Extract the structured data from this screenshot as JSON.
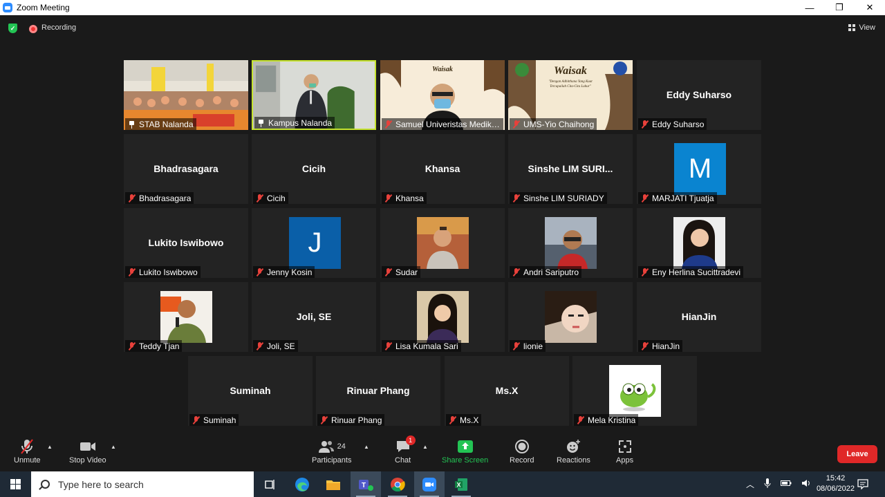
{
  "window": {
    "title": "Zoom Meeting",
    "min": "—",
    "restore": "❐",
    "close": "✕"
  },
  "topbar": {
    "recording_label": "Recording",
    "view_label": "View"
  },
  "tiles": [
    {
      "name": "STAB Nalanda",
      "icon": "pin",
      "kind": "video"
    },
    {
      "name": "Kampus Nalanda",
      "icon": "pin",
      "kind": "video",
      "active": true
    },
    {
      "name": "Samuel Univeristas Medika...",
      "icon": "mic-off",
      "kind": "video"
    },
    {
      "name": "UMS-Yio Chaihong",
      "icon": "mic-off",
      "kind": "video"
    },
    {
      "name": "Eddy Suharso",
      "big": "Eddy Suharso",
      "icon": "mic-off"
    },
    {
      "name": "Bhadrasagara",
      "big": "Bhadrasagara",
      "icon": "mic-off"
    },
    {
      "name": "Cicih",
      "big": "Cicih",
      "icon": "mic-off"
    },
    {
      "name": "Khansa",
      "big": "Khansa",
      "icon": "mic-off"
    },
    {
      "name": "Sinshe LIM SURIADY",
      "big": "Sinshe  LIM SURI...",
      "icon": "mic-off"
    },
    {
      "name": "MARJATI Tjuatja",
      "avatar": "M",
      "avatar_color": "#0a84d0",
      "icon": "mic-off"
    },
    {
      "name": "Lukito Iswibowo",
      "big": "Lukito Iswibowo",
      "icon": "mic-off"
    },
    {
      "name": "Jenny Kosin",
      "avatar": "J",
      "avatar_color": "#0a5fa8",
      "icon": "mic-off"
    },
    {
      "name": "Sudar",
      "photo": "sudar",
      "icon": "mic-off"
    },
    {
      "name": "Andri Sariputro",
      "photo": "andri",
      "icon": "mic-off"
    },
    {
      "name": "Eny Herlina Sucittradevi",
      "photo": "eny",
      "icon": "mic-off"
    },
    {
      "name": "Teddy Tjan",
      "photo": "teddy",
      "icon": "mic-off"
    },
    {
      "name": "Joli, SE",
      "big": "Joli, SE",
      "icon": "mic-off"
    },
    {
      "name": "Lisa Kumala Sari",
      "photo": "lisa",
      "icon": "mic-off"
    },
    {
      "name": "lionie",
      "photo": "lionie",
      "icon": "mic-off"
    },
    {
      "name": "HianJin",
      "big": "HianJin",
      "icon": "mic-off"
    },
    {
      "name": "Suminah",
      "big": "Suminah",
      "icon": "mic-off"
    },
    {
      "name": "Rinuar Phang",
      "big": "Rinuar Phang",
      "icon": "mic-off"
    },
    {
      "name": "Ms.X",
      "big": "Ms.X",
      "icon": "mic-off"
    },
    {
      "name": "Mela Kristina",
      "photo": "mela",
      "icon": "mic-off"
    }
  ],
  "video_text": {
    "waisak": "Waisak",
    "waisak_sub1": "\"Dengan Adhitthana Yang Kuat",
    "waisak_sub2": "Tercapailah Cita-Cita Luhur\""
  },
  "toolbar": {
    "unmute": "Unmute",
    "stop_video": "Stop Video",
    "participants": "Participants",
    "participants_count": "24",
    "chat": "Chat",
    "chat_badge": "1",
    "share_screen": "Share Screen",
    "record": "Record",
    "reactions": "Reactions",
    "apps": "Apps",
    "leave": "Leave",
    "share_color": "#23c454",
    "leave_color": "#e02828"
  },
  "taskbar": {
    "search_placeholder": "Type here to search",
    "time": "15:42",
    "date": "08/06/2022"
  }
}
